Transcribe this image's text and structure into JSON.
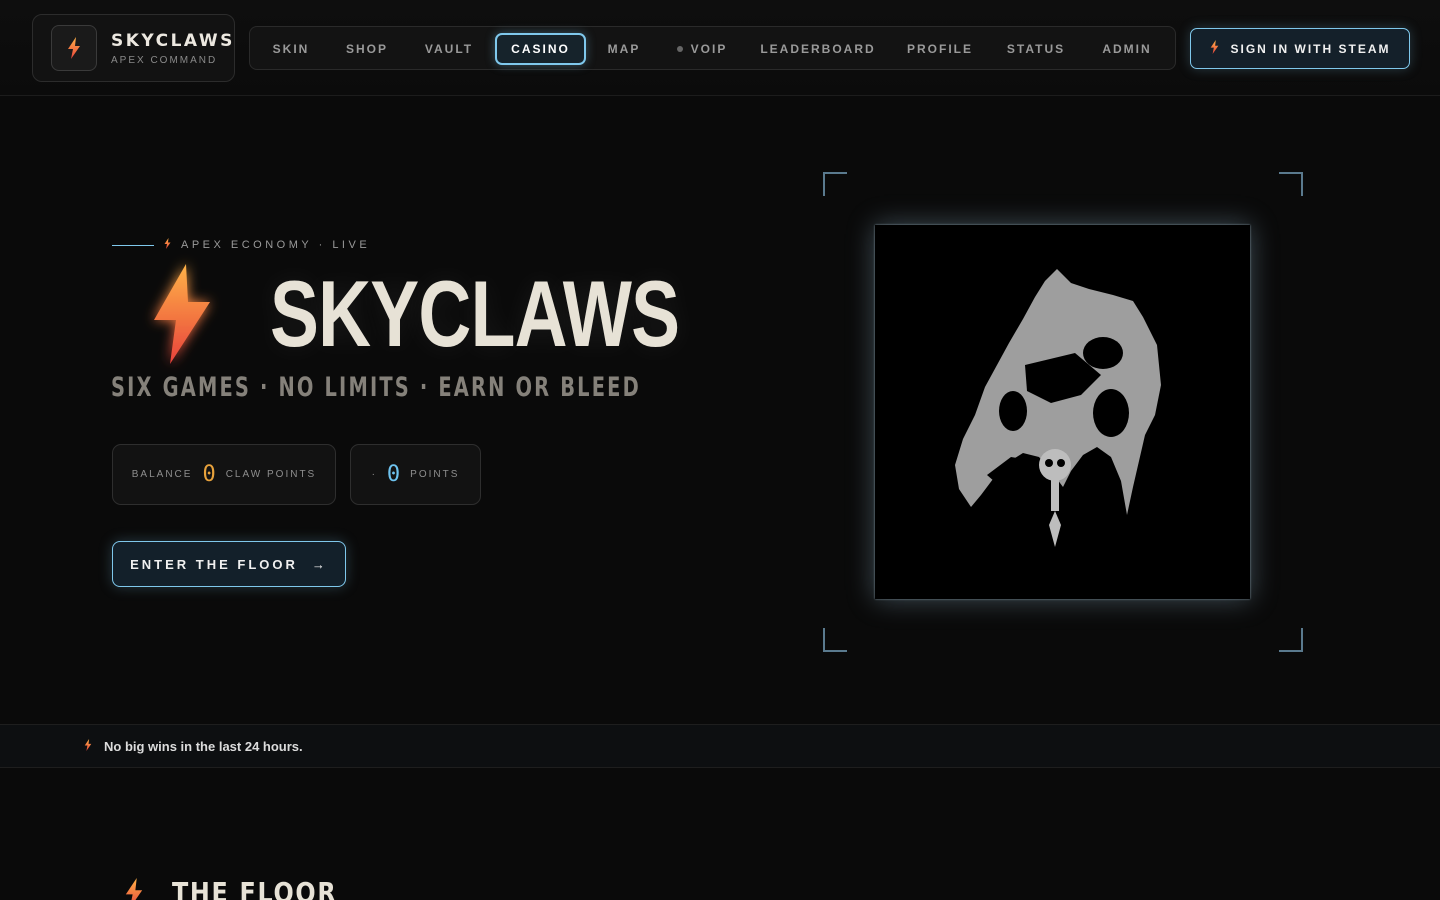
{
  "brand": {
    "title": "SKYCLAWS",
    "subtitle": "APEX COMMAND"
  },
  "nav": {
    "items": [
      {
        "label": "SKIN"
      },
      {
        "label": "SHOP"
      },
      {
        "label": "VAULT"
      },
      {
        "label": "CASINO",
        "active": true
      },
      {
        "label": "MAP"
      },
      {
        "label": "VOIP"
      },
      {
        "label": "LEADERBOARD"
      },
      {
        "label": "PROFILE"
      },
      {
        "label": "STATUS"
      },
      {
        "label": "ADMIN"
      }
    ],
    "signin_label": "SIGN IN WITH STEAM"
  },
  "hero": {
    "eyebrow": "APEX ECONOMY · LIVE",
    "title": "SKYCLAWS",
    "tagline": "SIX GAMES · NO LIMITS · EARN OR BLEED",
    "balance_label": "BALANCE",
    "balance_value": "0",
    "balance_unit": "CLAW POINTS",
    "points_prefix": "·",
    "points_value": "0",
    "points_unit": "POINTS",
    "cta_label": "ENTER THE FLOOR",
    "cta_arrow": "→"
  },
  "ticker": {
    "message": "No big wins in the last 24 hours."
  },
  "floor": {
    "title": "THE FLOOR"
  },
  "icons": {
    "bolt": "lightning-bolt-icon",
    "arrow": "arrow-right-icon",
    "art": "creature-skull-emblem"
  },
  "colors": {
    "accent": "#7fc8ec",
    "gold": "#e8a23c",
    "bolt_top": "#ffb347",
    "bolt_bottom": "#e8423c",
    "background": "#0a0a0a"
  }
}
